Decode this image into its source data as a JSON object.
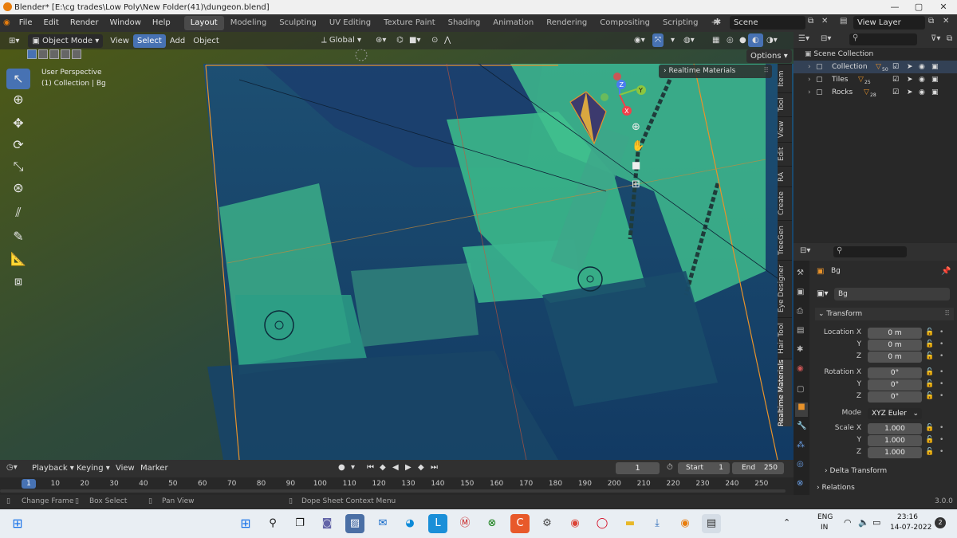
{
  "window": {
    "title": "Blender* [E:\\cg trades\\Low Poly\\New Folder(41)\\dungeon.blend]",
    "controls": [
      "—",
      "▢",
      "✕"
    ]
  },
  "menu": [
    "File",
    "Edit",
    "Render",
    "Window",
    "Help"
  ],
  "workspaces": [
    "Layout",
    "Modeling",
    "Sculpting",
    "UV Editing",
    "Texture Paint",
    "Shading",
    "Animation",
    "Rendering",
    "Compositing",
    "Scripting"
  ],
  "add_workspace": "+",
  "scene": {
    "label": "Scene",
    "view_layer": "View Layer"
  },
  "viewport_header": {
    "mode": "Object Mode",
    "view": "View",
    "select": "Select",
    "add": "Add",
    "object": "Object",
    "orientation": "Global",
    "options": "Options"
  },
  "viewport_overlay": {
    "perspective": "User Perspective",
    "collection": "(1) Collection | Bg",
    "panel_title": "Realtime Materials"
  },
  "sidebar_tabs": [
    "Item",
    "Tool",
    "View",
    "Edit",
    "RA",
    "Create",
    "TreeGen",
    "Eye Designer",
    "Hair Tool",
    "Realtime Materials"
  ],
  "outliner": {
    "root": "Scene Collection",
    "items": [
      {
        "name": "Collection",
        "count": "50"
      },
      {
        "name": "Tiles",
        "count": "25"
      },
      {
        "name": "Rocks",
        "count": "28"
      }
    ]
  },
  "properties": {
    "object_name": "Bg",
    "data_name": "Bg",
    "transform_header": "Transform",
    "location_label": "Location X",
    "rotation_label": "Rotation X",
    "scale_label": "Scale X",
    "y_label": "Y",
    "z_label": "Z",
    "location": [
      "0 m",
      "0 m",
      "0 m"
    ],
    "rotation": [
      "0°",
      "0°",
      "0°"
    ],
    "mode_label": "Mode",
    "mode_value": "XYZ Euler",
    "scale": [
      "1.000",
      "1.000",
      "1.000"
    ],
    "delta_transform": "Delta Transform",
    "relations": "Relations"
  },
  "timeline": {
    "playback": "Playback",
    "keying": "Keying",
    "view": "View",
    "marker": "Marker",
    "current_frame": "1",
    "start_label": "Start",
    "start": "1",
    "end_label": "End",
    "end": "250",
    "ticks": [
      "10",
      "20",
      "30",
      "40",
      "50",
      "60",
      "70",
      "80",
      "90",
      "100",
      "110",
      "120",
      "130",
      "140",
      "150",
      "160",
      "170",
      "180",
      "190",
      "200",
      "210",
      "220",
      "230",
      "240",
      "250"
    ],
    "playhead": "1"
  },
  "statusbar": {
    "change_frame": "Change Frame",
    "box_select": "Box Select",
    "pan_view": "Pan View",
    "context_menu": "Dope Sheet Context Menu",
    "version": "3.0.0"
  },
  "taskbar": {
    "lang": "ENG",
    "region": "IN",
    "time": "23:16",
    "date": "14-07-2022",
    "notifications": "2"
  },
  "colors": {
    "accent": "#4772b3",
    "header": "#303030",
    "panel": "#2b2b2b",
    "orange_outline": "#e8922a"
  }
}
